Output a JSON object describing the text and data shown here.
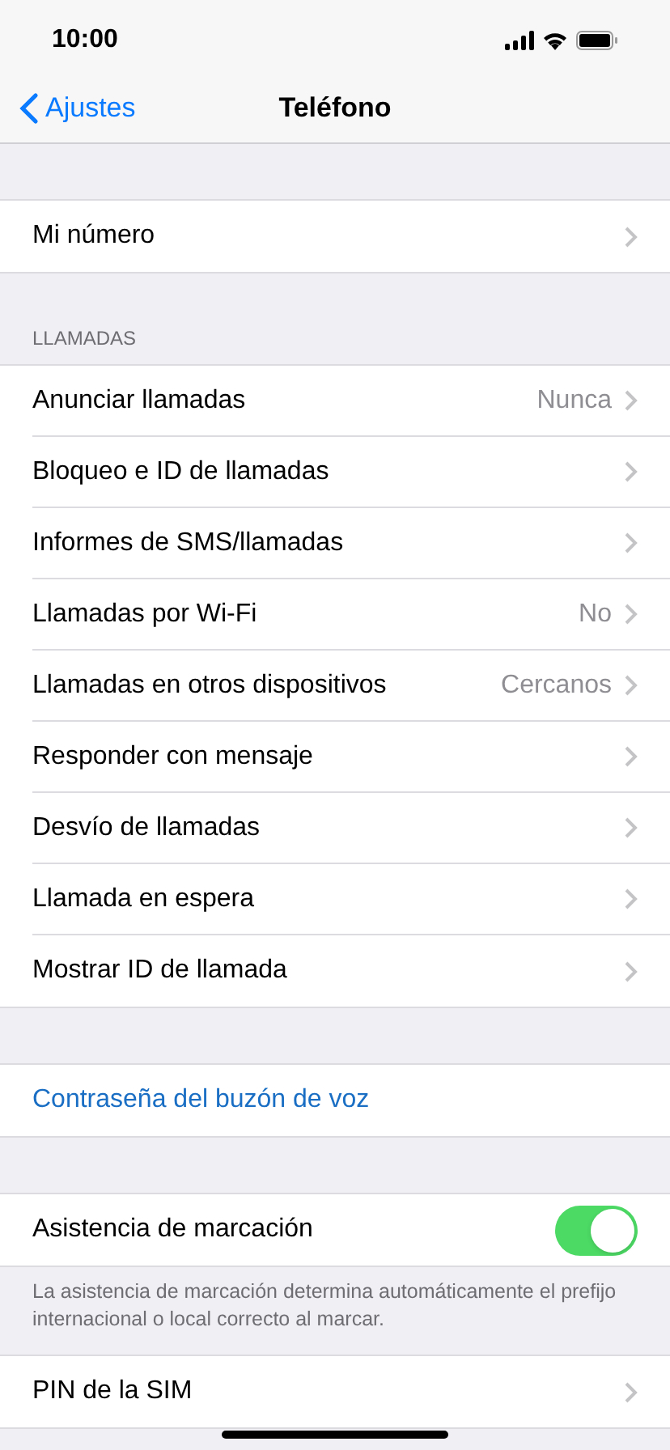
{
  "status_bar": {
    "time": "10:00"
  },
  "nav": {
    "back": "Ajustes",
    "title": "Teléfono"
  },
  "sections": [
    {
      "rows": [
        {
          "kind": "nav",
          "label": "Mi número"
        }
      ]
    },
    {
      "header": "LLAMADAS",
      "rows": [
        {
          "kind": "nav",
          "label": "Anunciar llamadas",
          "value": "Nunca"
        },
        {
          "kind": "nav",
          "label": "Bloqueo e ID de llamadas"
        },
        {
          "kind": "nav",
          "label": "Informes de SMS/llamadas"
        },
        {
          "kind": "nav",
          "label": "Llamadas por Wi-Fi",
          "value": "No"
        },
        {
          "kind": "nav",
          "label": "Llamadas en otros dispositivos",
          "value": "Cercanos"
        },
        {
          "kind": "nav",
          "label": "Responder con mensaje"
        },
        {
          "kind": "nav",
          "label": "Desvío de llamadas"
        },
        {
          "kind": "nav",
          "label": "Llamada en espera"
        },
        {
          "kind": "nav",
          "label": "Mostrar ID de llamada"
        }
      ]
    },
    {
      "rows": [
        {
          "kind": "link",
          "label": "Contraseña del buzón de voz"
        }
      ]
    },
    {
      "rows": [
        {
          "kind": "toggle",
          "label": "Asistencia de marcación",
          "on": true
        }
      ],
      "footer": "La asistencia de marcación determina automáticamente el prefijo internacional o local correcto al marcar."
    },
    {
      "rows": [
        {
          "kind": "nav",
          "label": "PIN de la SIM"
        }
      ]
    }
  ]
}
